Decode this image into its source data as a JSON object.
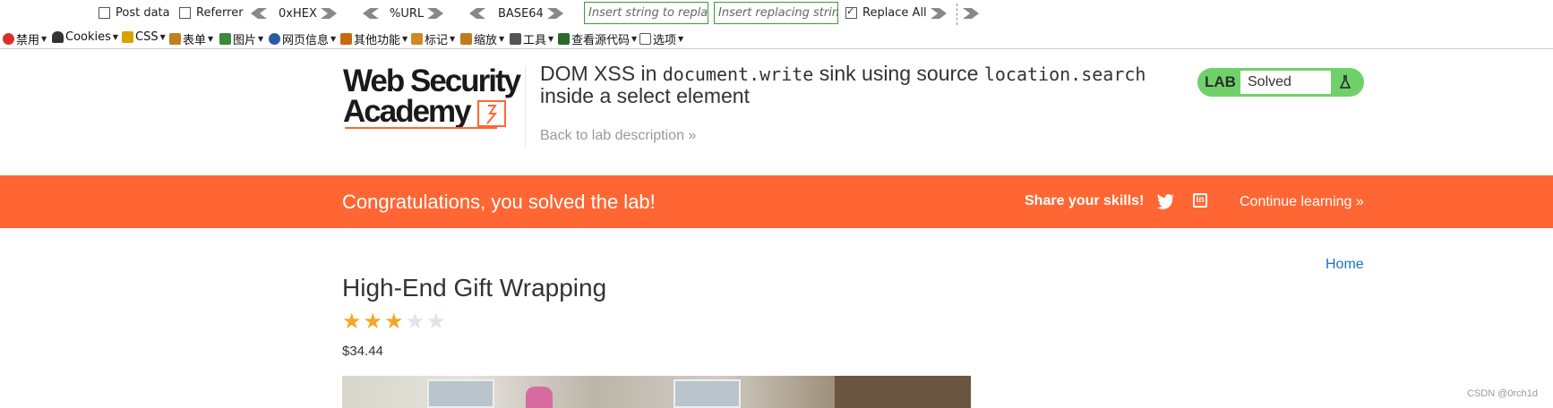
{
  "toolbar1": {
    "post_data": "Post data",
    "post_data_checked": false,
    "referrer": "Referrer",
    "referrer_checked": false,
    "hex": "0xHEX",
    "url": "%URL",
    "base64": "BASE64",
    "replace_placeholder": "Insert string to replace",
    "replacing_placeholder": "Insert replacing string",
    "replace_all": "Replace All",
    "replace_all_checked": true
  },
  "toolbar2": {
    "items": [
      "禁用",
      "Cookies",
      "CSS",
      "表单",
      "图片",
      "网页信息",
      "其他功能",
      "标记",
      "缩放",
      "工具",
      "查看源代码",
      "选项"
    ],
    "icon_colors": [
      "#d9302a",
      "#333333",
      "#d8a200",
      "#c08020",
      "#3a8a3a",
      "#2a5aa0",
      "#c86a10",
      "#d08a20",
      "#c07a20",
      "#555555",
      "#2a6a2a",
      "#555555"
    ]
  },
  "header": {
    "logo_line1": "Web Security",
    "logo_line2": "Academy",
    "title_part1": "DOM XSS in ",
    "title_code1": "document.write",
    "title_part2": " sink using source ",
    "title_code2": "location.search",
    "title_part3": "inside a select element",
    "back_link": "Back to lab description",
    "lab_label": "LAB",
    "lab_status": "Solved"
  },
  "banner": {
    "congrats": "Congratulations, you solved the lab!",
    "share": "Share your skills!",
    "continue": "Continue learning"
  },
  "content": {
    "home": "Home",
    "product_title": "High-End Gift Wrapping",
    "rating": 3,
    "rating_max": 5,
    "price": "$34.44"
  },
  "watermark": "CSDN @0rch1d",
  "colors": {
    "accent": "#ff6633",
    "lab_green": "#70d16a",
    "link_blue": "#1a73c6",
    "star_gold": "#f5a623",
    "star_empty": "#dfe4e8"
  }
}
